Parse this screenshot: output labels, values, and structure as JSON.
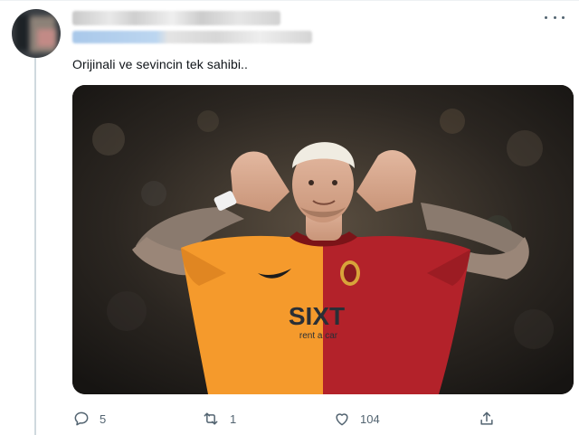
{
  "tweet": {
    "text": "Orijinali ve sevincin tek sahibi..",
    "image": {
      "alt_semantic": "football-player-celebration-photo",
      "sponsor_text": "SIXT",
      "sponsor_subtext": "rent a car"
    }
  },
  "actions": {
    "reply_count": "5",
    "retweet_count": "1",
    "like_count": "104"
  },
  "colors": {
    "icon_gray": "#536471",
    "thread_line": "#cfd9de",
    "jersey_orange": "#f59a2c",
    "jersey_red": "#b3222a"
  },
  "icons": [
    "more-icon",
    "reply-icon",
    "retweet-icon",
    "like-icon",
    "share-icon"
  ]
}
